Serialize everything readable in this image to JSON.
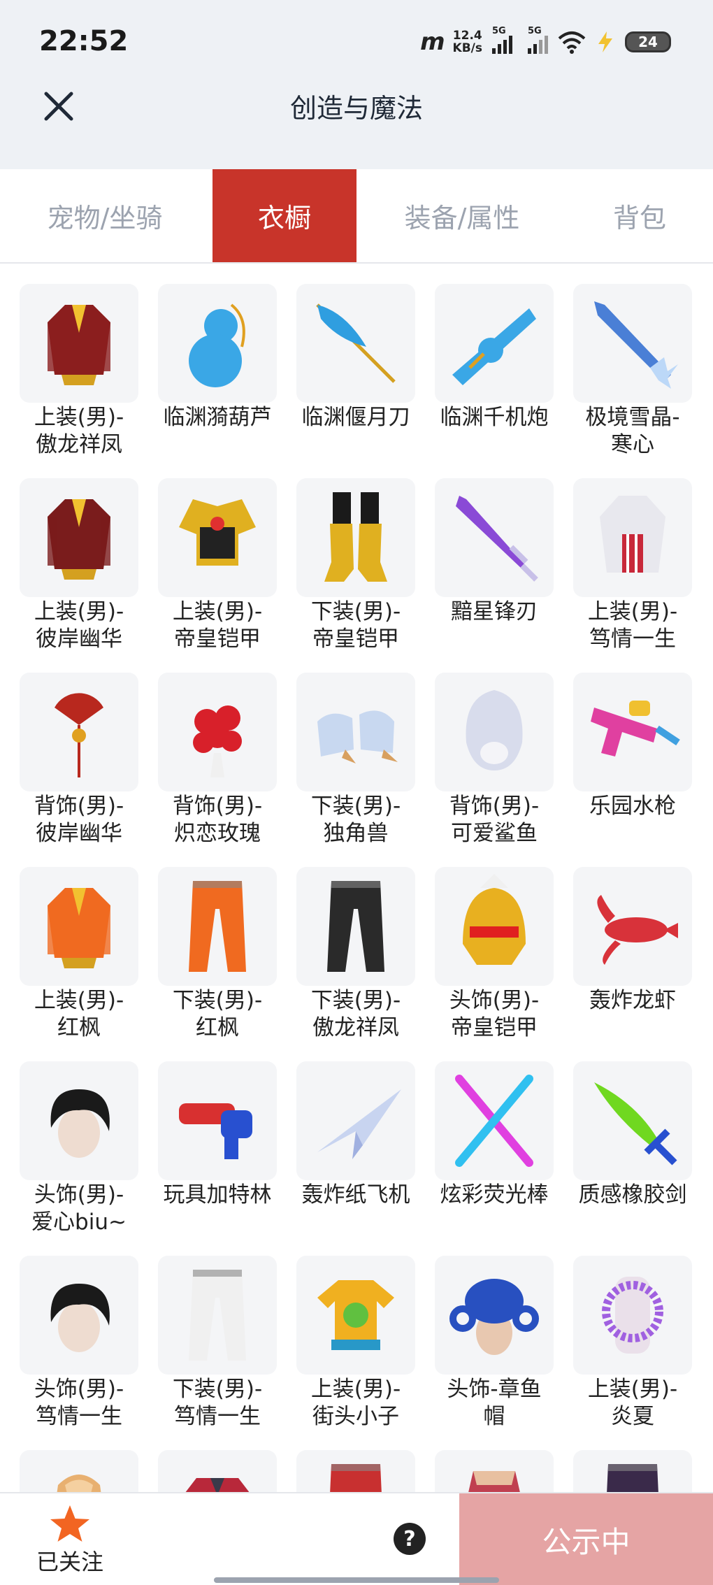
{
  "status": {
    "time": "22:52",
    "carrier_logo": "m",
    "net_speed_value": "12.4",
    "net_speed_unit": "KB/s",
    "signal1_label": "5G",
    "signal2_label": "5G",
    "battery": "24"
  },
  "header": {
    "title": "创造与魔法"
  },
  "tabs": [
    {
      "label": "宠物/坐骑"
    },
    {
      "label": "衣橱"
    },
    {
      "label": "装备/属性"
    },
    {
      "label": "背包"
    }
  ],
  "active_tab": 1,
  "items": [
    {
      "name": "上装(男)-\n傲龙祥凤",
      "icon": "robe-icon",
      "color": "#8b1e1e"
    },
    {
      "name": "临渊漪葫芦",
      "icon": "gourd-icon",
      "color": "#3aa7e6"
    },
    {
      "name": "临渊偃月刀",
      "icon": "glaive-icon",
      "color": "#2f9ee0"
    },
    {
      "name": "临渊千机炮",
      "icon": "cannon-icon",
      "color": "#3aa7e6"
    },
    {
      "name": "极境雪晶-\n寒心",
      "icon": "ice-sword-icon",
      "color": "#4a7fd6"
    },
    {
      "name": "上装(男)-\n彼岸幽华",
      "icon": "robe-icon",
      "color": "#7a1c1c"
    },
    {
      "name": "上装(男)-\n帝皇铠甲",
      "icon": "armor-icon",
      "color": "#e0b020"
    },
    {
      "name": "下装(男)-\n帝皇铠甲",
      "icon": "boots-icon",
      "color": "#e0b020"
    },
    {
      "name": "黯星锋刃",
      "icon": "sword-icon",
      "color": "#8a4ad6"
    },
    {
      "name": "上装(男)-\n笃情一生",
      "icon": "coat-icon",
      "color": "#e8e8ee"
    },
    {
      "name": "背饰(男)-\n彼岸幽华",
      "icon": "fan-icon",
      "color": "#b8281e"
    },
    {
      "name": "背饰(男)-\n炽恋玫瑰",
      "icon": "rose-icon",
      "color": "#d8202a"
    },
    {
      "name": "下装(男)-\n独角兽",
      "icon": "shoes-icon",
      "color": "#c8d8f0"
    },
    {
      "name": "背饰(男)-\n可爱鲨鱼",
      "icon": "shark-icon",
      "color": "#d8dcec"
    },
    {
      "name": "乐园水枪",
      "icon": "water-gun-icon",
      "color": "#e040a0"
    },
    {
      "name": "上装(男)-\n红枫",
      "icon": "robe-icon",
      "color": "#f06a20"
    },
    {
      "name": "下装(男)-\n红枫",
      "icon": "pants-icon",
      "color": "#f06a20"
    },
    {
      "name": "下装(男)-\n傲龙祥凤",
      "icon": "pants-icon",
      "color": "#2a2a2a"
    },
    {
      "name": "头饰(男)-\n帝皇铠甲",
      "icon": "helmet-icon",
      "color": "#e8b020"
    },
    {
      "name": "轰炸龙虾",
      "icon": "lobster-icon",
      "color": "#d8323a"
    },
    {
      "name": "头饰(男)-\n爱心biu~",
      "icon": "hair-icon",
      "color": "#1a1a1a"
    },
    {
      "name": "玩具加特林",
      "icon": "gatling-icon",
      "color": "#2850d0"
    },
    {
      "name": "轰炸纸飞机",
      "icon": "plane-icon",
      "color": "#c8d4f0"
    },
    {
      "name": "炫彩荧光棒",
      "icon": "glowstick-icon",
      "color": "#e040e0"
    },
    {
      "name": "质感橡胶剑",
      "icon": "rubber-sword-icon",
      "color": "#70d820"
    },
    {
      "name": "头饰(男)-\n笃情一生",
      "icon": "hair-icon",
      "color": "#1a1a1a"
    },
    {
      "name": "下装(男)-\n笃情一生",
      "icon": "pants-icon",
      "color": "#f0f0f0"
    },
    {
      "name": "上装(男)-\n街头小子",
      "icon": "tshirt-icon",
      "color": "#f0b020"
    },
    {
      "name": "头饰-章鱼\n帽",
      "icon": "octopus-icon",
      "color": "#2850c0"
    },
    {
      "name": "上装(男)-\n炎夏",
      "icon": "lei-icon",
      "color": "#a060e0"
    },
    {
      "name": "",
      "icon": "hoodie-icon",
      "color": "#e8b070"
    },
    {
      "name": "",
      "icon": "jacket-icon",
      "color": "#b8283a"
    },
    {
      "name": "",
      "icon": "pants-icon",
      "color": "#c83030"
    },
    {
      "name": "",
      "icon": "skirt-icon",
      "color": "#c04050"
    },
    {
      "name": "",
      "icon": "pants-icon",
      "color": "#3a2a4a"
    }
  ],
  "bottom": {
    "follow_label": "已关注",
    "help_label": "?",
    "publish_label": "公示中"
  },
  "colors": {
    "accent": "#c8342a",
    "publish": "#e5a4a4",
    "star": "#f26522"
  }
}
